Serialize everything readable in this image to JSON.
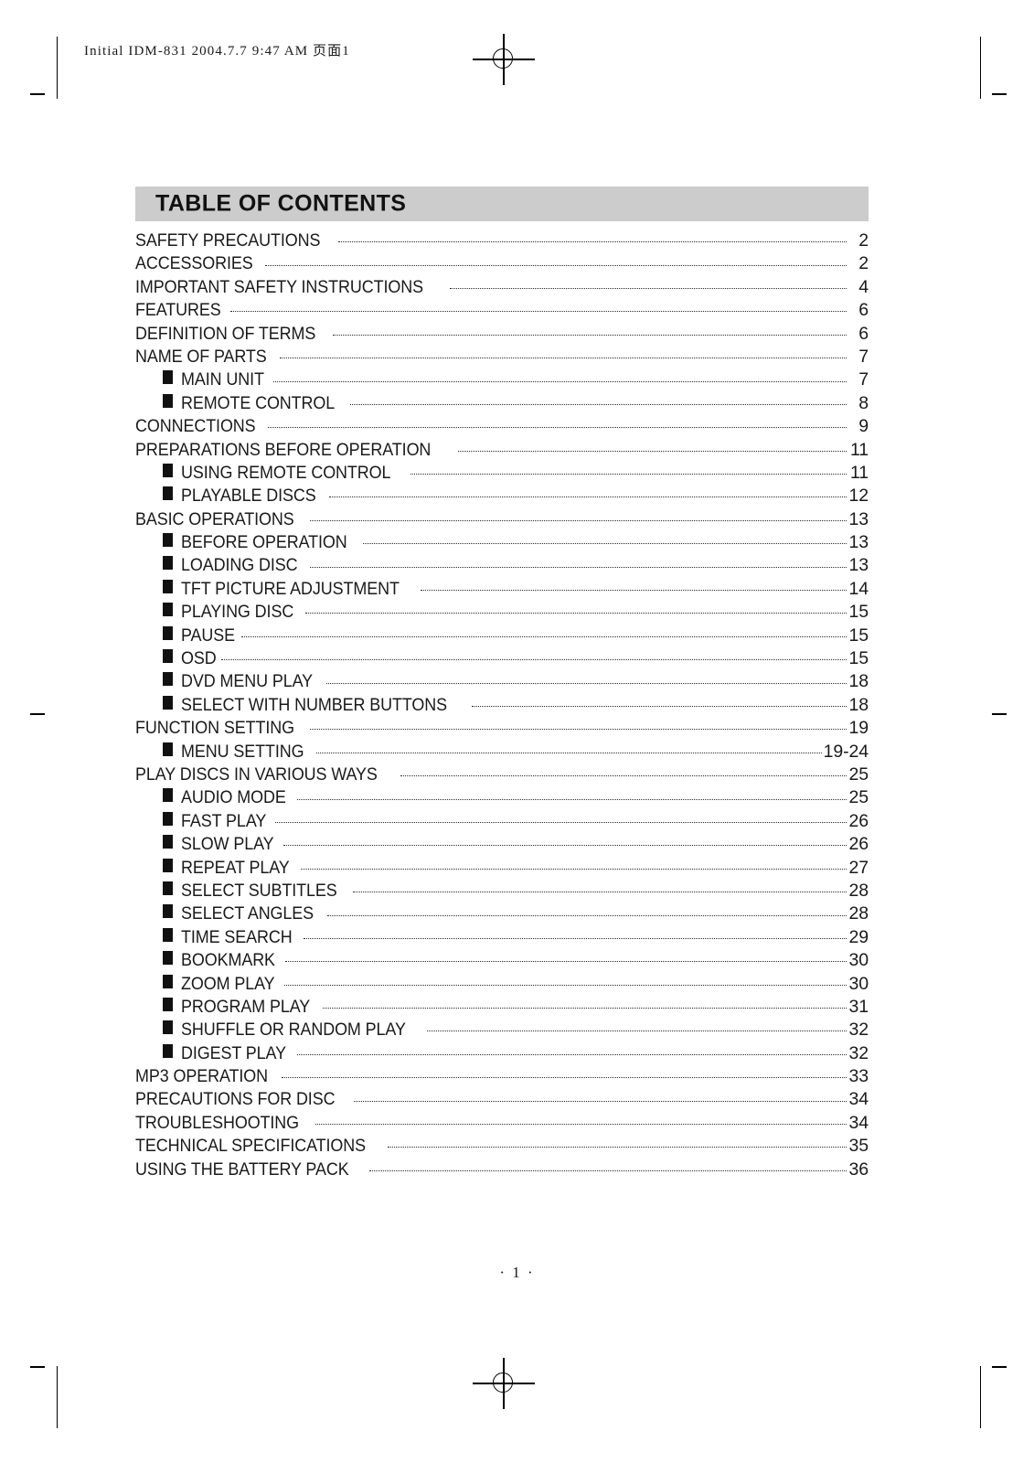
{
  "header": {
    "slug": "Initial IDM-831  2004.7.7 9:47 AM 页面1"
  },
  "title_bar": {
    "title": "TABLE OF CONTENTS"
  },
  "footer": {
    "page_marker": "· 1 ·"
  },
  "toc": {
    "entries": [
      {
        "label": "SAFETY PRECAUTIONS",
        "page": "2",
        "level": 0
      },
      {
        "label": "ACCESSORIES",
        "page": "2",
        "level": 0
      },
      {
        "label": "IMPORTANT SAFETY INSTRUCTIONS",
        "page": "4",
        "level": 0
      },
      {
        "label": "FEATURES",
        "page": "6",
        "level": 0
      },
      {
        "label": "DEFINITION OF TERMS",
        "page": "6",
        "level": 0
      },
      {
        "label": "NAME OF PARTS",
        "page": "7",
        "level": 0
      },
      {
        "label": "MAIN UNIT",
        "page": "7",
        "level": 1
      },
      {
        "label": "REMOTE CONTROL",
        "page": "8",
        "level": 1
      },
      {
        "label": "CONNECTIONS",
        "page": "9",
        "level": 0
      },
      {
        "label": "PREPARATIONS BEFORE OPERATION",
        "page": "11",
        "level": 0
      },
      {
        "label": "USING REMOTE CONTROL",
        "page": "11",
        "level": 1
      },
      {
        "label": "PLAYABLE DISCS",
        "page": "12",
        "level": 1
      },
      {
        "label": "BASIC OPERATIONS",
        "page": "13",
        "level": 0
      },
      {
        "label": "BEFORE OPERATION",
        "page": "13",
        "level": 1
      },
      {
        "label": "LOADING DISC",
        "page": "13",
        "level": 1
      },
      {
        "label": "TFT PICTURE ADJUSTMENT",
        "page": "14",
        "level": 1
      },
      {
        "label": "PLAYING DISC",
        "page": "15",
        "level": 1
      },
      {
        "label": "PAUSE",
        "page": "15",
        "level": 1
      },
      {
        "label": "OSD",
        "page": "15",
        "level": 1
      },
      {
        "label": "DVD MENU PLAY",
        "page": "18",
        "level": 1
      },
      {
        "label": "SELECT WITH NUMBER BUTTONS",
        "page": "18",
        "level": 1
      },
      {
        "label": "FUNCTION SETTING",
        "page": "19",
        "level": 0
      },
      {
        "label": "MENU SETTING",
        "page": "19-24",
        "level": 1
      },
      {
        "label": "PLAY DISCS IN VARIOUS WAYS",
        "page": "25",
        "level": 0
      },
      {
        "label": "AUDIO MODE",
        "page": "25",
        "level": 1
      },
      {
        "label": "FAST PLAY",
        "page": "26",
        "level": 1
      },
      {
        "label": "SLOW PLAY",
        "page": "26",
        "level": 1
      },
      {
        "label": "REPEAT PLAY",
        "page": "27",
        "level": 1
      },
      {
        "label": "SELECT SUBTITLES",
        "page": "28",
        "level": 1
      },
      {
        "label": "SELECT ANGLES",
        "page": "28",
        "level": 1
      },
      {
        "label": "TIME SEARCH",
        "page": "29",
        "level": 1
      },
      {
        "label": "BOOKMARK",
        "page": "30",
        "level": 1
      },
      {
        "label": "ZOOM PLAY",
        "page": "30",
        "level": 1
      },
      {
        "label": "PROGRAM PLAY",
        "page": "31",
        "level": 1
      },
      {
        "label": "SHUFFLE OR RANDOM PLAY",
        "page": "32",
        "level": 1
      },
      {
        "label": "DIGEST PLAY",
        "page": "32",
        "level": 1
      },
      {
        "label": "MP3 OPERATION",
        "page": "33",
        "level": 0
      },
      {
        "label": "PRECAUTIONS FOR DISC",
        "page": "34",
        "level": 0
      },
      {
        "label": "TROUBLESHOOTING",
        "page": "34",
        "level": 0
      },
      {
        "label": "TECHNICAL SPECIFICATIONS",
        "page": "35",
        "level": 0
      },
      {
        "label": "USING THE BATTERY PACK",
        "page": "36",
        "level": 0
      }
    ]
  }
}
